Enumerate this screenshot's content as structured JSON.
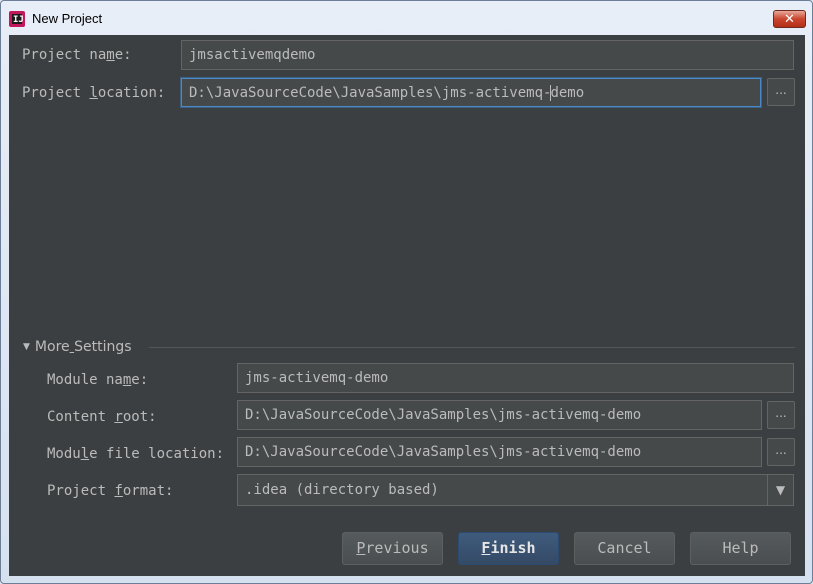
{
  "window": {
    "title": "New Project",
    "close_label": "✕"
  },
  "project": {
    "name_label_pre": "Project na",
    "name_label_mn": "m",
    "name_label_post": "e:",
    "name_value": "jmsactivemqdemo",
    "location_label_pre": "Project ",
    "location_label_mn": "l",
    "location_label_post": "ocation:",
    "location_value_before_caret": "D:\\JavaSourceCode\\JavaSamples\\jms-activemq-",
    "location_value_after_caret": "demo",
    "browse_label": "..."
  },
  "more_settings": {
    "label_pre": "More",
    "label_mn": " ",
    "label_post": "Settings",
    "arrow": "▼",
    "module_name_label_pre": "Module na",
    "module_name_label_mn": "m",
    "module_name_label_post": "e:",
    "module_name_value": "jms-activemq-demo",
    "content_root_label_pre": "Content ",
    "content_root_label_mn": "r",
    "content_root_label_post": "oot:",
    "content_root_value": "D:\\JavaSourceCode\\JavaSamples\\jms-activemq-demo",
    "module_file_label_pre": "Modu",
    "module_file_label_mn": "l",
    "module_file_label_post": "e file location:",
    "module_file_value": "D:\\JavaSourceCode\\JavaSamples\\jms-activemq-demo",
    "format_label_pre": "Project ",
    "format_label_mn": "f",
    "format_label_post": "ormat:",
    "format_value": ".idea (directory based)",
    "combo_arrow": "▼",
    "browse_label": "..."
  },
  "buttons": {
    "previous_mn": "P",
    "previous_rest": "revious",
    "finish_mn": "F",
    "finish_rest": "inish",
    "cancel": "Cancel",
    "help": "Help"
  }
}
